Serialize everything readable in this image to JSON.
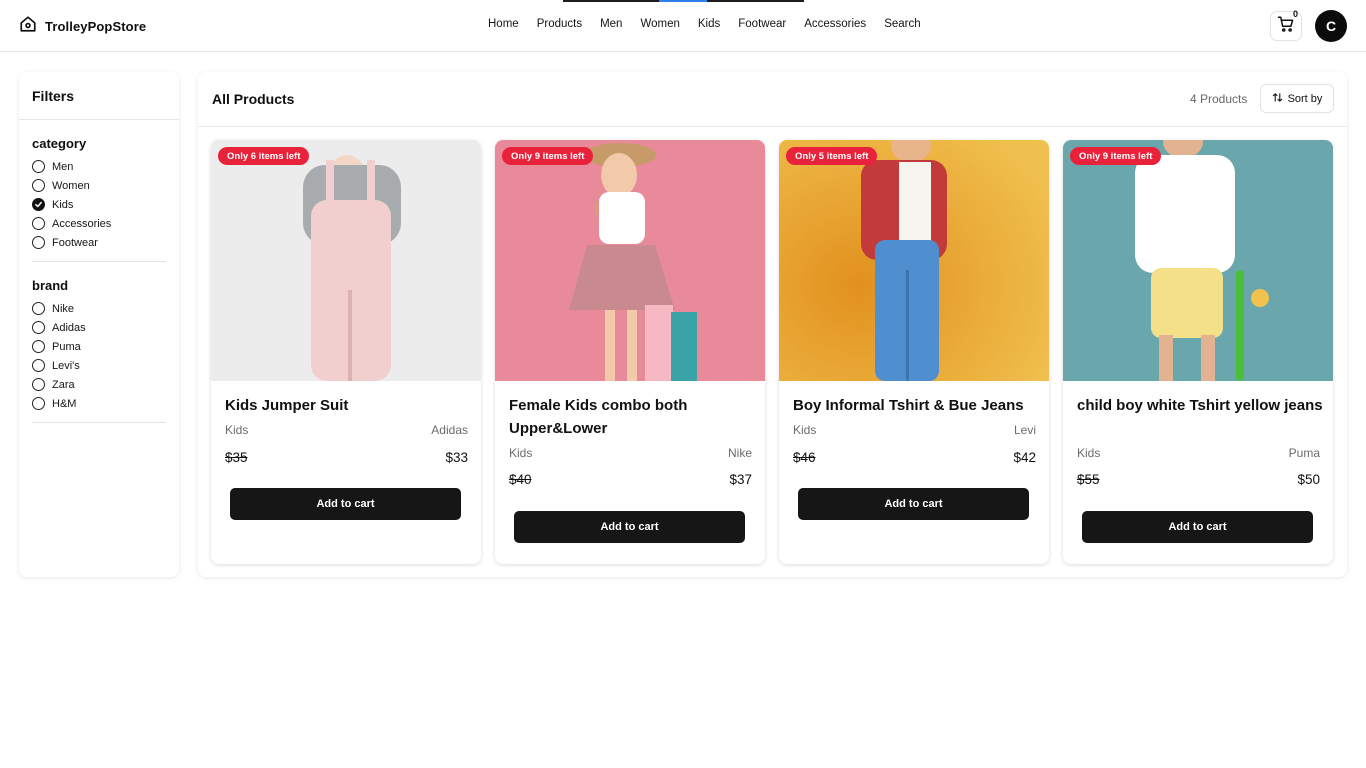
{
  "header": {
    "brand": "TrolleyPopStore",
    "nav": [
      "Home",
      "Products",
      "Men",
      "Women",
      "Kids",
      "Footwear",
      "Accessories",
      "Search"
    ],
    "cart_count": "0",
    "avatar_initial": "C"
  },
  "filters": {
    "title": "Filters",
    "category": {
      "title": "category",
      "options": [
        {
          "label": "Men",
          "checked": false
        },
        {
          "label": "Women",
          "checked": false
        },
        {
          "label": "Kids",
          "checked": true
        },
        {
          "label": "Accessories",
          "checked": false
        },
        {
          "label": "Footwear",
          "checked": false
        }
      ]
    },
    "brand": {
      "title": "brand",
      "options": [
        {
          "label": "Nike",
          "checked": false
        },
        {
          "label": "Adidas",
          "checked": false
        },
        {
          "label": "Puma",
          "checked": false
        },
        {
          "label": "Levi's",
          "checked": false
        },
        {
          "label": "Zara",
          "checked": false
        },
        {
          "label": "H&M",
          "checked": false
        }
      ]
    }
  },
  "main": {
    "title": "All Products",
    "count": "4 Products",
    "sort_label": "Sort by"
  },
  "products": [
    {
      "badge": "Only 6 items left",
      "name": "Kids Jumper Suit",
      "category": "Kids",
      "brand": "Adidas",
      "old_price": "$35",
      "price": "$33",
      "button": "Add to cart",
      "bg": "#ececec"
    },
    {
      "badge": "Only 9 items left",
      "name": "Female Kids combo both Upper&Lower",
      "category": "Kids",
      "brand": "Nike",
      "old_price": "$40",
      "price": "$37",
      "button": "Add to cart",
      "bg": "#e98a9a"
    },
    {
      "badge": "Only 5 items left",
      "name": "Boy Informal Tshirt & Bue Jeans",
      "category": "Kids",
      "brand": "Levi",
      "old_price": "$46",
      "price": "$42",
      "button": "Add to cart",
      "bg": "#ecb23a"
    },
    {
      "badge": "Only 9 items left",
      "name": "child boy white Tshirt yellow jeans",
      "category": "Kids",
      "brand": "Puma",
      "old_price": "$55",
      "price": "$50",
      "button": "Add to cart",
      "bg": "#6aa7ad"
    }
  ],
  "colors": {
    "accent": "#161616",
    "badge": "#e8223a",
    "nav_underline": "#2f80ed"
  }
}
